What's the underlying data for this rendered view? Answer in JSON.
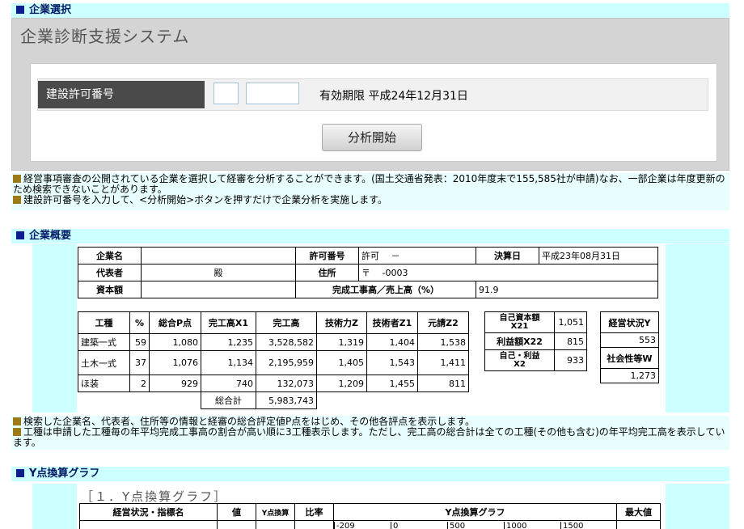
{
  "section1": {
    "title": "企業選択"
  },
  "panel": {
    "title": "企業診断支援システム",
    "field_label": "建設許可番号",
    "input1": "",
    "input2": "",
    "validity": "有効期限 平成24年12月31日",
    "button": "分析開始"
  },
  "notes1": [
    "経営事項審査の公開されている企業を選択して経審を分析することができます。(国土交通省発表：2010年度末で155,585社が申請)なお、一部企業は年度更新のため検索できないことがあります。",
    "建設許可番号を入力して、<分析開始>ボタンを押すだけで企業分析を実施します。"
  ],
  "section2": {
    "title": "企業概要"
  },
  "overview": {
    "company_label": "企業名",
    "company": "",
    "permit_label": "許可番号",
    "permit": "許可　 －",
    "settle_label": "決算日",
    "settle": "平成23年08月31日",
    "rep_label": "代表者",
    "rep": "殿",
    "addr_label": "住所",
    "addr": "〒　 -0003",
    "capital_label": "資本額",
    "capital": "",
    "ratio_label": "完成工事高／売上高（%）",
    "ratio": "91.9"
  },
  "works": {
    "headers": [
      "工種",
      "%",
      "総合P点",
      "完工高X1",
      "完工高",
      "技術力Z",
      "技術者Z1",
      "元請Z2"
    ],
    "rows": [
      [
        "建築一式",
        "59",
        "1,080",
        "1,235",
        "3,528,582",
        "1,319",
        "1,404",
        "1,538"
      ],
      [
        "土木一式",
        "37",
        "1,076",
        "1,134",
        "2,195,959",
        "1,405",
        "1,543",
        "1,411"
      ],
      [
        "ほ装",
        "2",
        "929",
        "740",
        "132,073",
        "1,209",
        "1,455",
        "811"
      ]
    ],
    "total_label": "総合計",
    "total": "5,983,743"
  },
  "capital_table": {
    "r1_label": "自己資本額\nX21",
    "r1": "1,051",
    "r2_label": "利益額X22",
    "r2": "815",
    "r3_label": "自己・利益\nX2",
    "r3": "933"
  },
  "status_table": {
    "label1": "経営状況Y",
    "val1": "553",
    "label2": "社会性等W",
    "val2": "1,273"
  },
  "notes2": [
    "検索した企業名、代表者、住所等の情報と経審の総合評定値P点をはじめ、その他各評点を表示します。",
    "工種は申請した工種毎の年平均完成工事高の割合が高い順に3工種表示します。ただし、完工高の総合計は全ての工種(その他も含む)の年平均完工高を表示しています。"
  ],
  "section3": {
    "title": "Y点換算グラフ"
  },
  "ygraph": {
    "title": "［１．Y点換算グラフ］",
    "headers": [
      "経営状況・指標名",
      "値",
      "Y点換算",
      "比率",
      "Y点換算グラフ",
      "最大値"
    ],
    "scale": [
      "-209",
      "0",
      "500",
      "1000",
      "1500"
    ]
  },
  "colors": {
    "section_bg": "#ccffff",
    "section_text": "#001a66",
    "square": "#0d1e8c",
    "bullet": "#9c7a18",
    "panel_bg": "#d4d4d4",
    "label_bg": "#4a4a4a"
  }
}
